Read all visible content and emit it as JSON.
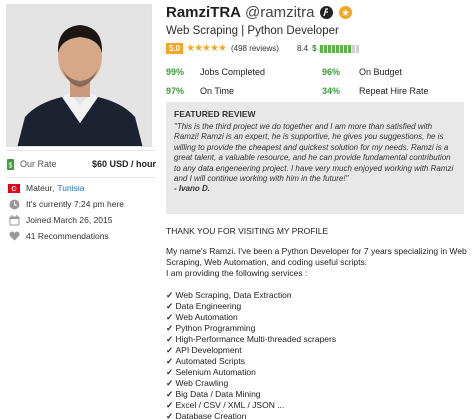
{
  "profile": {
    "name": "RamziTRA",
    "handle": "@ramzitra",
    "title": "Web Scraping | Python Developer",
    "rating_score": "5.0",
    "reviews": "(498 reviews)",
    "earnings_score": "8.4",
    "earnings_symbol": "$",
    "stars_filled": 5
  },
  "left": {
    "rate_label": "Our Rate",
    "rate_value": "$60 USD / hour",
    "location_city": "Mateur,",
    "location_country": "Tunisia",
    "local_time": "It's currently 7:24 pm here",
    "joined": "Joined March 26, 2015",
    "recommendations": "41 Recommendations"
  },
  "stats": [
    {
      "pct": "99%",
      "label": "Jobs Completed",
      "pct2": "96%",
      "label2": "On Budget"
    },
    {
      "pct": "97%",
      "label": "On Time",
      "pct2": "34%",
      "label2": "Repeat Hire Rate"
    }
  ],
  "review": {
    "heading": "FEATURED REVIEW",
    "text": "\"This is the third project we do together and I am more than satisfied with Ramzi! Ramzi is an expert, he is supportive, he gives you suggestions, he is willing to provide the cheapest and quickest solution for my needs. Ramzi is a great talent, a valuable resource, and he can provide fundamental contribution to any data engeneering project. I have very much enjoyed working with Ramzi and I will continue working with him in the future!\"",
    "author": "- Ivano D."
  },
  "description": {
    "thanks": "THANK YOU FOR VISITING MY PROFILE",
    "intro1": "My name's Ramzi. I've been a Python Developer for 7 years specializing in Web Scraping, Web Automation, and coding useful scripts.",
    "intro2": "I am providing the following services :",
    "services": [
      "Web Scraping, Data Extraction",
      "Data Engineering",
      "Web Automation",
      "Python Programming",
      "High-Performance Multi-threaded scrapers",
      "API Development",
      "Automated Scripts",
      "Selenium Automation",
      "Web Crawling",
      "Big Data / Data Mining",
      "Excel / CSV / XML / JSON ...",
      "Database Creation"
    ]
  },
  "colors": {
    "accent_green": "#3a9e3a",
    "star_orange": "#f5a623",
    "link_blue": "#1a73c6",
    "tunisia_red": "#e70013"
  }
}
